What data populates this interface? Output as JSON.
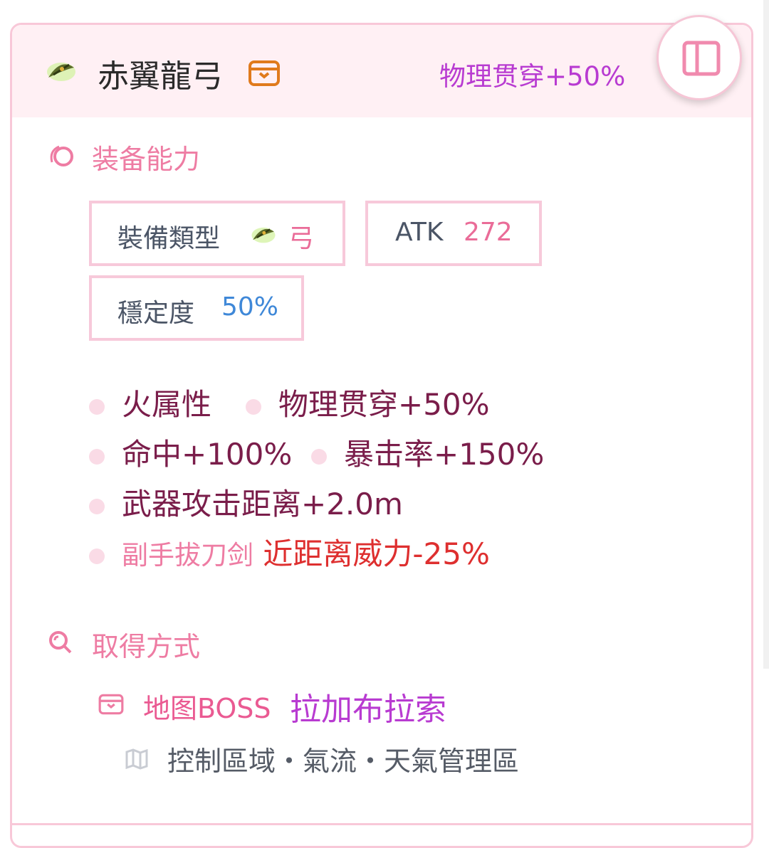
{
  "item": {
    "name": "赤翼龍弓",
    "header_stat": "物理贯穿+50%",
    "icon": "bow-icon",
    "source_badge_icon": "boss-chest-icon"
  },
  "toggle": {
    "icon": "sidebar-panel-icon"
  },
  "ability_section": {
    "title": "装备能力",
    "icon": "ring-icon",
    "type_label": "裝備類型",
    "type_value": "弓",
    "atk_label": "ATK",
    "atk_value": "272",
    "stability_label": "穩定度",
    "stability_value": "50%"
  },
  "traits": [
    "火属性",
    "物理贯穿+50%",
    "命中+100%",
    "暴击率+150%",
    "武器攻击距离+2.0m"
  ],
  "special_trait": {
    "condition": "副手拔刀剑",
    "effect": "近距离威力-25%"
  },
  "source_section": {
    "title": "取得方式",
    "icon": "search-icon",
    "source_type": "地图BOSS",
    "source_name": "拉加布拉索",
    "location_icon": "map-icon",
    "location": "控制區域・氣流・天氣管理區"
  },
  "colors": {
    "accent_pink": "#ee7ca3",
    "purple": "#b83bd1",
    "trait_text": "#7a1d4a",
    "negative_red": "#de2f2f",
    "stability_blue": "#3f88d8"
  }
}
